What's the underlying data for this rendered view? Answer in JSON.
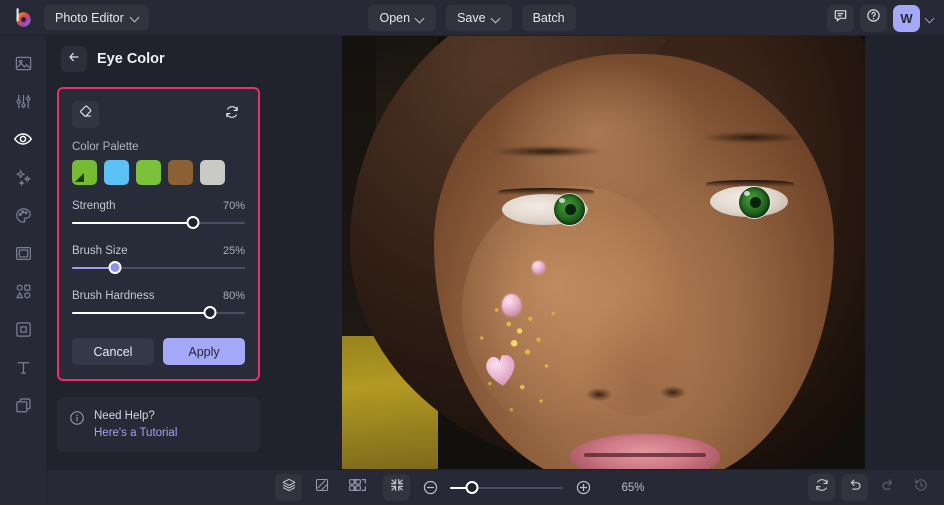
{
  "topbar": {
    "logo_icon": "colorwheel-logo-icon",
    "app_switcher_label": "Photo Editor",
    "app_switcher_chevron": "chevron-down-icon",
    "open_label": "Open",
    "save_label": "Save",
    "batch_label": "Batch",
    "feedback_icon": "chat-bubble-icon",
    "help_icon": "question-circle-icon",
    "avatar_initial": "W",
    "avatar_chevron": "chevron-down-icon",
    "avatar_color": "#a5a8f7"
  },
  "rail": {
    "items": [
      {
        "name": "image-icon",
        "active": false
      },
      {
        "name": "adjust-icon",
        "active": false
      },
      {
        "name": "eye-icon",
        "active": true
      },
      {
        "name": "sparkles-icon",
        "active": false
      },
      {
        "name": "palette-icon",
        "active": false
      },
      {
        "name": "frame-icon",
        "active": false
      },
      {
        "name": "shapes-icon",
        "active": false
      },
      {
        "name": "crop-icon",
        "active": false
      },
      {
        "name": "text-icon",
        "active": false
      },
      {
        "name": "layers-icon",
        "active": false
      }
    ]
  },
  "panel": {
    "back_icon": "arrow-left-icon",
    "title": "Eye Color",
    "highlight_color": "#ed2e67",
    "eraser_icon": "eraser-icon",
    "reset_icon": "reset-icon",
    "palette_label": "Color Palette",
    "swatches": [
      {
        "name": "swatch-green-selected",
        "color": "#76bb33",
        "selected": true
      },
      {
        "name": "swatch-sky-blue",
        "color": "#5bc1f5",
        "selected": false
      },
      {
        "name": "swatch-light-green",
        "color": "#7cc13a",
        "selected": false
      },
      {
        "name": "swatch-brown",
        "color": "#8a6034",
        "selected": false
      },
      {
        "name": "swatch-light-gray",
        "color": "#c9c9c6",
        "selected": false
      }
    ],
    "sliders": [
      {
        "name": "strength",
        "label": "Strength",
        "value": "70%",
        "percent": 70,
        "fill": "#ffffff",
        "knob": "hollow"
      },
      {
        "name": "brush-size",
        "label": "Brush Size",
        "value": "25%",
        "percent": 25,
        "fill": "#9b9ef0",
        "knob": "filled"
      },
      {
        "name": "brush-hardness",
        "label": "Brush Hardness",
        "value": "80%",
        "percent": 80,
        "fill": "#ffffff",
        "knob": "hollow"
      }
    ],
    "cancel_label": "Cancel",
    "apply_label": "Apply",
    "apply_color": "#a5a8f7",
    "help_icon": "info-circle-icon",
    "help_title": "Need Help?",
    "help_link": "Here's a Tutorial"
  },
  "bottombar": {
    "layers_icon": "layers-stack-icon",
    "transparency_icon": "transparency-icon",
    "grid_icon": "grid-icon",
    "fullscreen_icon": "expand-icon",
    "fit_icon": "fit-to-screen-icon",
    "zoom_out_icon": "zoom-out-icon",
    "zoom_in_icon": "zoom-in-icon",
    "zoom_level": "65%",
    "zoom_percent": 20,
    "reset_icon": "reset-icon",
    "undo_icon": "undo-icon",
    "redo_icon": "redo-icon",
    "history_icon": "history-clock-icon"
  },
  "canvas": {
    "image_alt": "portrait-photo-with-green-eye-color-applied"
  }
}
